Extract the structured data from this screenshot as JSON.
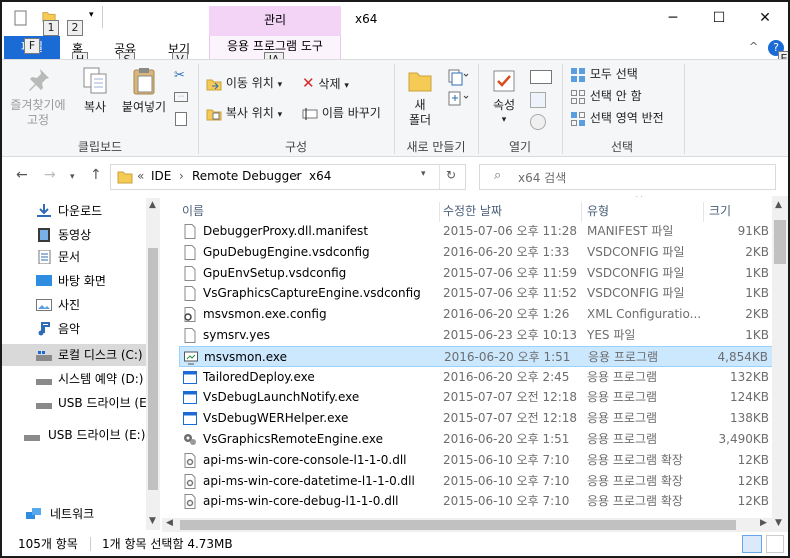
{
  "qat": {
    "keytips": [
      "1",
      "2"
    ]
  },
  "window": {
    "title": "x64",
    "contextual_group": "관리",
    "contextual_tab": "응용 프로그램 도구",
    "contextual_keytip": "JA",
    "controls": {
      "minimize": "─",
      "maximize": "☐",
      "close": "✕"
    },
    "help_keytip": "E",
    "help_symbol": "?",
    "collapse_symbol": "^"
  },
  "ribbon_tabs": [
    {
      "label": "파일",
      "keytip": "F"
    },
    {
      "label": "홈",
      "keytip": "H"
    },
    {
      "label": "공유",
      "keytip": "S"
    },
    {
      "label": "보기",
      "keytip": "V"
    }
  ],
  "ribbon": {
    "clipboard": {
      "pin_label": "즐겨찾기에\n고정",
      "copy_label": "복사",
      "paste_label": "붙여넣기",
      "group_label": "클립보드"
    },
    "organize": {
      "move_to": "이동 위치",
      "copy_to": "복사 위치",
      "delete": "삭제",
      "rename": "이름 바꾸기",
      "group_label": "구성"
    },
    "new": {
      "new_folder": "새\n폴더",
      "group_label": "새로 만들기"
    },
    "open": {
      "properties": "속성",
      "group_label": "열기"
    },
    "select": {
      "select_all": "모두 선택",
      "select_none": "선택 안 함",
      "invert": "선택 영역 반전",
      "group_label": "선택"
    }
  },
  "address": {
    "overflow": "«",
    "crumbs": [
      "IDE",
      "Remote Debugger",
      "x64"
    ],
    "separator": "›",
    "search_placeholder": "x64 검색"
  },
  "nav_pane": {
    "items": [
      {
        "label": "다운로드",
        "icon": "download-icon"
      },
      {
        "label": "동영상",
        "icon": "video-icon"
      },
      {
        "label": "문서",
        "icon": "document-icon"
      },
      {
        "label": "바탕 화면",
        "icon": "desktop-icon"
      },
      {
        "label": "사진",
        "icon": "picture-icon"
      },
      {
        "label": "음악",
        "icon": "music-icon"
      },
      {
        "label": "로컬 디스크 (C:)",
        "icon": "drive-icon"
      },
      {
        "label": "시스템 예약 (D:)",
        "icon": "drive-icon"
      },
      {
        "label": "USB 드라이브 (E:)",
        "icon": "usb-drive-icon"
      },
      {
        "label": "USB 드라이브 (E:)",
        "icon": "usb-drive-icon"
      },
      {
        "label": "네트워크",
        "icon": "network-icon"
      }
    ]
  },
  "columns": {
    "name": "이름",
    "date": "수정한 날짜",
    "type": "유형",
    "size": "크기"
  },
  "files": [
    {
      "name": "DebuggerProxy.dll.manifest",
      "date": "2015-07-06 오후 11:28",
      "type": "MANIFEST 파일",
      "size": "91KB",
      "icon": "file-icon"
    },
    {
      "name": "GpuDebugEngine.vsdconfig",
      "date": "2016-06-20 오후 1:33",
      "type": "VSDCONFIG 파일",
      "size": "2KB",
      "icon": "file-icon"
    },
    {
      "name": "GpuEnvSetup.vsdconfig",
      "date": "2015-07-06 오후 11:59",
      "type": "VSDCONFIG 파일",
      "size": "1KB",
      "icon": "file-icon"
    },
    {
      "name": "VsGraphicsCaptureEngine.vsdconfig",
      "date": "2015-07-06 오후 11:52",
      "type": "VSDCONFIG 파일",
      "size": "1KB",
      "icon": "file-icon"
    },
    {
      "name": "msvsmon.exe.config",
      "date": "2016-06-20 오후 1:26",
      "type": "XML Configuratio...",
      "size": "2KB",
      "icon": "config-file-icon"
    },
    {
      "name": "symsrv.yes",
      "date": "2015-06-23 오후 10:13",
      "type": "YES 파일",
      "size": "1KB",
      "icon": "file-icon"
    },
    {
      "name": "msvsmon.exe",
      "date": "2016-06-20 오후 1:51",
      "type": "응용 프로그램",
      "size": "4,854KB",
      "icon": "monitor-app-icon",
      "selected": true
    },
    {
      "name": "TailoredDeploy.exe",
      "date": "2016-06-20 오후 2:45",
      "type": "응용 프로그램",
      "size": "132KB",
      "icon": "app-window-icon"
    },
    {
      "name": "VsDebugLaunchNotify.exe",
      "date": "2015-07-07 오전 12:18",
      "type": "응용 프로그램",
      "size": "124KB",
      "icon": "app-window-icon"
    },
    {
      "name": "VsDebugWERHelper.exe",
      "date": "2015-07-07 오전 12:18",
      "type": "응용 프로그램",
      "size": "138KB",
      "icon": "app-window-icon"
    },
    {
      "name": "VsGraphicsRemoteEngine.exe",
      "date": "2016-06-20 오후 1:51",
      "type": "응용 프로그램",
      "size": "3,490KB",
      "icon": "gears-app-icon"
    },
    {
      "name": "api-ms-win-core-console-l1-1-0.dll",
      "date": "2015-06-10 오후 7:10",
      "type": "응용 프로그램 확장",
      "size": "12KB",
      "icon": "dll-icon"
    },
    {
      "name": "api-ms-win-core-datetime-l1-1-0.dll",
      "date": "2015-06-10 오후 7:10",
      "type": "응용 프로그램 확장",
      "size": "12KB",
      "icon": "dll-icon"
    },
    {
      "name": "api-ms-win-core-debug-l1-1-0.dll",
      "date": "2015-06-10 오후 7:10",
      "type": "응용 프로그램 확장",
      "size": "12KB",
      "icon": "dll-icon"
    }
  ],
  "status": {
    "count": "105개 항목",
    "selection": "1개 항목 선택함 4.73MB"
  },
  "colors": {
    "accent": "#1a6bd6",
    "context_tab": "#f3d4f7",
    "selection": "#cce8ff",
    "selection_border": "#99d1ff",
    "header_text": "#4c607a"
  }
}
